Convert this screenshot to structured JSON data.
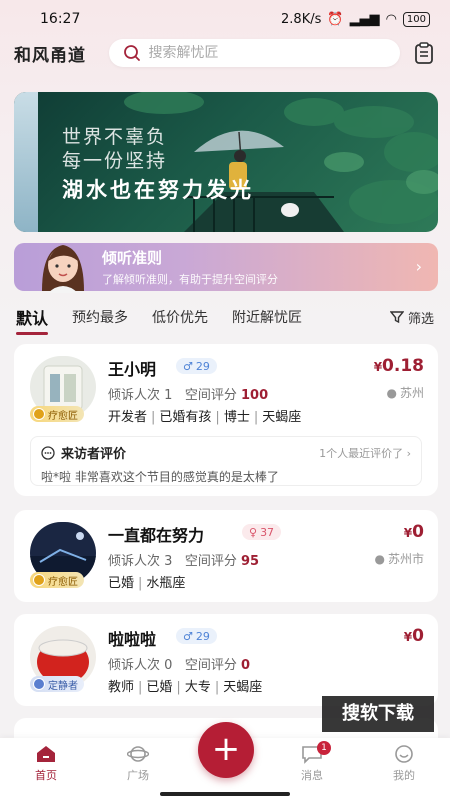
{
  "status": {
    "time": "16:27",
    "net_speed": "2.8K/s",
    "battery": "100"
  },
  "header": {
    "app_title": "和风甬道",
    "search_placeholder": "搜索解忧匠"
  },
  "banner": {
    "line1": "世界不辜负",
    "line2": "每一份坚持",
    "line3": "湖水也在努力发光"
  },
  "rules": {
    "title": "倾听准则",
    "subtitle": "了解倾听准则，有助于提升空间评分"
  },
  "tabs": [
    {
      "label": "默认"
    },
    {
      "label": "预约最多"
    },
    {
      "label": "低价优先"
    },
    {
      "label": "附近解忧匠"
    }
  ],
  "filter_label": "筛选",
  "listeners": [
    {
      "name": "王小明",
      "fans": "29",
      "badge": "疗愈匠",
      "price": "0.18",
      "currency": "¥",
      "visitors_label": "倾诉人次",
      "visitors": "1",
      "score_label": "空间评分",
      "score": "100",
      "location": "苏州",
      "tags": [
        "开发者",
        "已婚有孩",
        "博士",
        "天蝎座"
      ],
      "review": {
        "title": "来访者评价",
        "meta": "1个人最近评价了",
        "text": "啦*啦 非常喜欢这个节目的感觉真的是太棒了"
      }
    },
    {
      "name": "一直都在努力",
      "fans": "37",
      "badge": "疗愈匠",
      "price": "0",
      "currency": "¥",
      "visitors_label": "倾诉人次",
      "visitors": "3",
      "score_label": "空间评分",
      "score": "95",
      "location": "苏州市",
      "tags": [
        "已婚",
        "水瓶座"
      ]
    },
    {
      "name": "啦啦啦",
      "fans": "29",
      "badge": "定静者",
      "price": "0",
      "currency": "¥",
      "visitors_label": "倾诉人次",
      "visitors": "0",
      "score_label": "空间评分",
      "score": "0",
      "tags": [
        "教师",
        "已婚",
        "大专",
        "天蝎座"
      ]
    }
  ],
  "watermark": "搜软下载",
  "nav": [
    {
      "label": "首页"
    },
    {
      "label": "广场"
    },
    {
      "label": "消息",
      "badge": "1"
    },
    {
      "label": "我的"
    }
  ],
  "colors": {
    "accent": "#a4243b",
    "price": "#9e1f33",
    "fab": "#b51e35"
  }
}
